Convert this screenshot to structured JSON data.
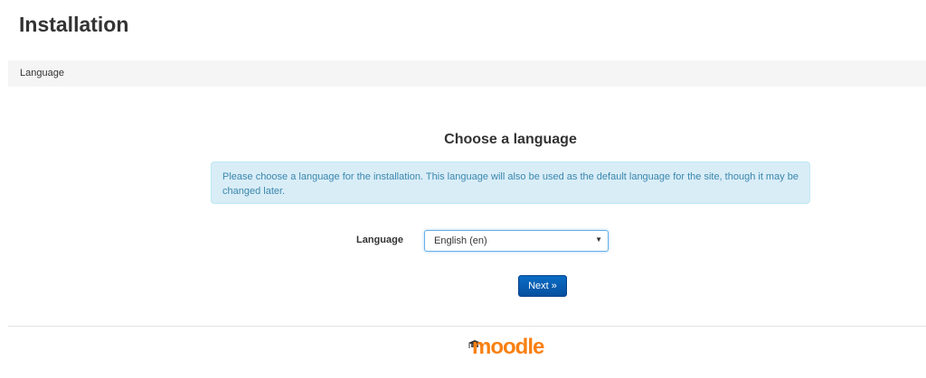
{
  "header": {
    "title": "Installation"
  },
  "breadcrumb": {
    "items": [
      {
        "label": "Language"
      }
    ]
  },
  "main": {
    "heading": "Choose a language",
    "info_text": "Please choose a language for the installation. This language will also be used as the default language for the site, though it may be changed later.",
    "language_label": "Language",
    "language_select": {
      "selected": "English (en)",
      "arrow_icon": "dropdown-arrow-icon"
    },
    "next_label": "Next »"
  },
  "footer": {
    "logo_text": "moodle",
    "logo_icon": "graduation-cap-icon"
  },
  "colors": {
    "info_bg": "#d9edf7",
    "info_text": "#3a87ad",
    "button": "#0a6cc4",
    "logo": "#f98012"
  }
}
